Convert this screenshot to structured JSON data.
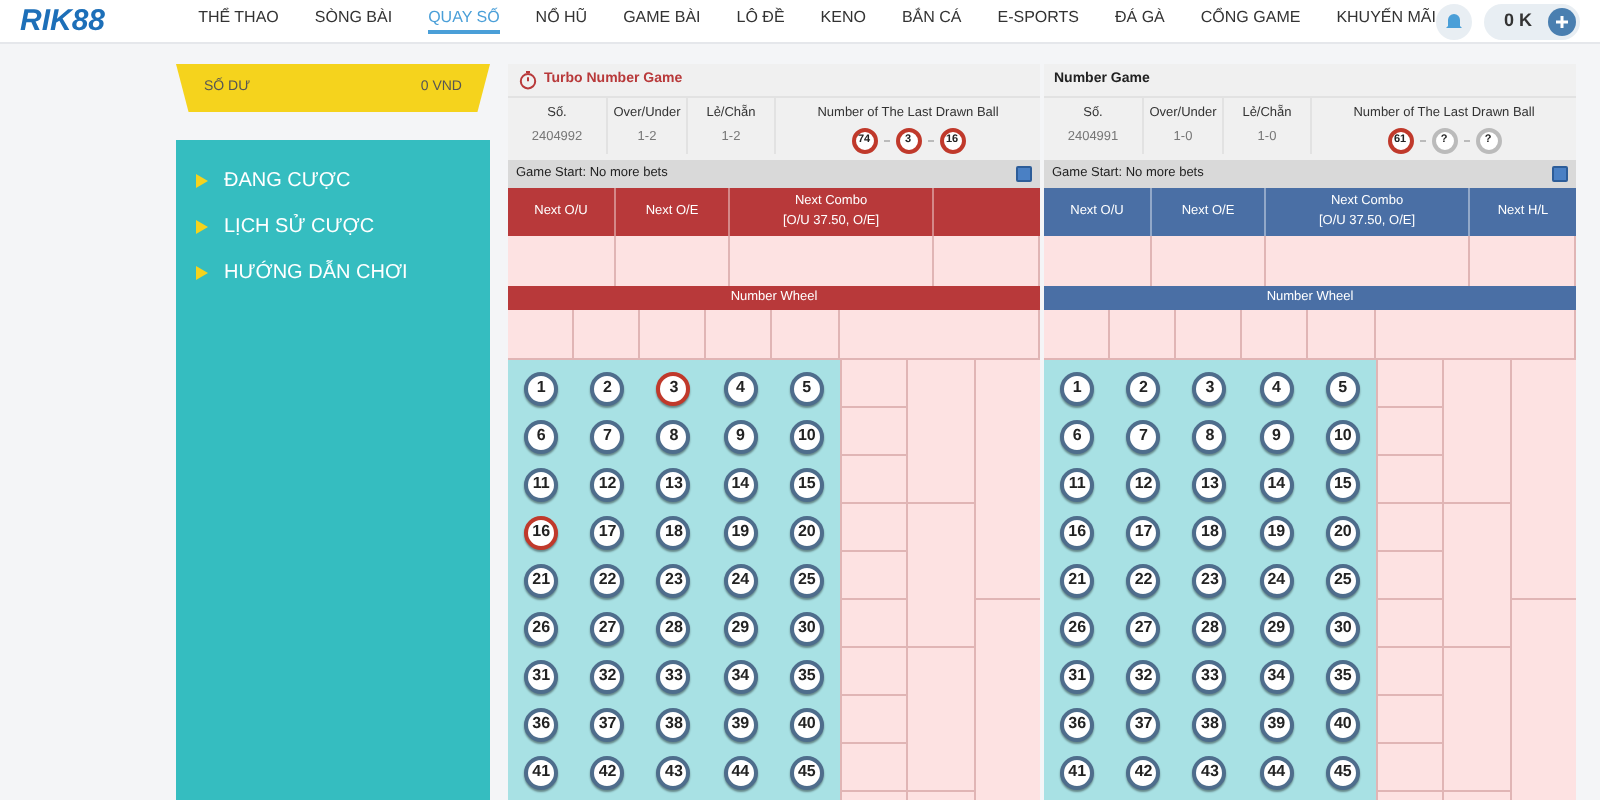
{
  "header": {
    "logo": "RIK88",
    "nav": [
      {
        "label": "THỂ THAO",
        "selected": false
      },
      {
        "label": "SÒNG BÀI",
        "selected": false
      },
      {
        "label": "QUAY SỐ",
        "selected": true
      },
      {
        "label": "NỔ HŨ",
        "selected": false
      },
      {
        "label": "GAME BÀI",
        "selected": false
      },
      {
        "label": "LÔ ĐỀ",
        "selected": false
      },
      {
        "label": "KENO",
        "selected": false
      },
      {
        "label": "BẮN CÁ",
        "selected": false
      },
      {
        "label": "E-SPORTS",
        "selected": false
      },
      {
        "label": "ĐÁ GÀ",
        "selected": false
      },
      {
        "label": "CỔNG GAME",
        "selected": false
      },
      {
        "label": "KHUYẾN MÃI",
        "selected": false
      }
    ],
    "balance": "0 K"
  },
  "sidebar": {
    "balance_label": "SỐ DƯ",
    "balance_value": "0 VND",
    "items": [
      "ĐANG CƯỢC",
      "LỊCH SỬ CƯỢC",
      "HƯỚNG DẪN CHƠI"
    ]
  },
  "panels": [
    {
      "kind": "turbo",
      "title": "Turbo Number Game",
      "info_labels": [
        "Số.",
        "Over/Under",
        "Lẻ/Chẵn",
        "Number of The Last Drawn Ball"
      ],
      "info_values": [
        "2404992",
        "1-2",
        "1-2"
      ],
      "last_balls": [
        {
          "label": "74",
          "drawn": true
        },
        {
          "label": "3",
          "drawn": true
        },
        {
          "label": "16",
          "drawn": true
        }
      ],
      "status": "Game Start: No more bets",
      "columns": [
        {
          "label": "Next O/U"
        },
        {
          "label": "Next O/E"
        },
        {
          "label": "Next Combo",
          "sublabel": "[O/U 37.50, O/E]"
        }
      ],
      "wheel_title": "Number Wheel",
      "balls": [
        {
          "label": "1",
          "drawn": false
        },
        {
          "label": "2",
          "drawn": false
        },
        {
          "label": "3",
          "drawn": true
        },
        {
          "label": "4",
          "drawn": false
        },
        {
          "label": "5",
          "drawn": false
        },
        {
          "label": "6",
          "drawn": false
        },
        {
          "label": "7",
          "drawn": false
        },
        {
          "label": "8",
          "drawn": false
        },
        {
          "label": "9",
          "drawn": false
        },
        {
          "label": "10",
          "drawn": false
        },
        {
          "label": "11",
          "drawn": false
        },
        {
          "label": "12",
          "drawn": false
        },
        {
          "label": "13",
          "drawn": false
        },
        {
          "label": "14",
          "drawn": false
        },
        {
          "label": "15",
          "drawn": false
        },
        {
          "label": "16",
          "drawn": true
        },
        {
          "label": "17",
          "drawn": false
        },
        {
          "label": "18",
          "drawn": false
        },
        {
          "label": "19",
          "drawn": false
        },
        {
          "label": "20",
          "drawn": false
        },
        {
          "label": "21",
          "drawn": false
        },
        {
          "label": "22",
          "drawn": false
        },
        {
          "label": "23",
          "drawn": false
        },
        {
          "label": "24",
          "drawn": false
        },
        {
          "label": "25",
          "drawn": false
        },
        {
          "label": "26",
          "drawn": false
        },
        {
          "label": "27",
          "drawn": false
        },
        {
          "label": "28",
          "drawn": false
        },
        {
          "label": "29",
          "drawn": false
        },
        {
          "label": "30",
          "drawn": false
        },
        {
          "label": "31",
          "drawn": false
        },
        {
          "label": "32",
          "drawn": false
        },
        {
          "label": "33",
          "drawn": false
        },
        {
          "label": "34",
          "drawn": false
        },
        {
          "label": "35",
          "drawn": false
        },
        {
          "label": "36",
          "drawn": false
        },
        {
          "label": "37",
          "drawn": false
        },
        {
          "label": "38",
          "drawn": false
        },
        {
          "label": "39",
          "drawn": false
        },
        {
          "label": "40",
          "drawn": false
        },
        {
          "label": "41",
          "drawn": false
        },
        {
          "label": "42",
          "drawn": false
        },
        {
          "label": "43",
          "drawn": false
        },
        {
          "label": "44",
          "drawn": false
        },
        {
          "label": "45",
          "drawn": false
        }
      ]
    },
    {
      "kind": "standard",
      "title": "Number Game",
      "info_labels": [
        "Số.",
        "Over/Under",
        "Lẻ/Chẵn",
        "Number of The Last Drawn Ball"
      ],
      "info_values": [
        "2404991",
        "1-0",
        "1-0"
      ],
      "last_balls": [
        {
          "label": "61",
          "drawn": true
        },
        {
          "label": "?",
          "drawn": false
        },
        {
          "label": "?",
          "drawn": false
        }
      ],
      "status": "Game Start: No more bets",
      "columns": [
        {
          "label": "Next O/U"
        },
        {
          "label": "Next O/E"
        },
        {
          "label": "Next Combo",
          "sublabel": "[O/U 37.50, O/E]"
        },
        {
          "label": "Next H/L"
        }
      ],
      "wheel_title": "Number Wheel",
      "balls": [
        {
          "label": "1",
          "drawn": false
        },
        {
          "label": "2",
          "drawn": false
        },
        {
          "label": "3",
          "drawn": false
        },
        {
          "label": "4",
          "drawn": false
        },
        {
          "label": "5",
          "drawn": false
        },
        {
          "label": "6",
          "drawn": false
        },
        {
          "label": "7",
          "drawn": false
        },
        {
          "label": "8",
          "drawn": false
        },
        {
          "label": "9",
          "drawn": false
        },
        {
          "label": "10",
          "drawn": false
        },
        {
          "label": "11",
          "drawn": false
        },
        {
          "label": "12",
          "drawn": false
        },
        {
          "label": "13",
          "drawn": false
        },
        {
          "label": "14",
          "drawn": false
        },
        {
          "label": "15",
          "drawn": false
        },
        {
          "label": "16",
          "drawn": false
        },
        {
          "label": "17",
          "drawn": false
        },
        {
          "label": "18",
          "drawn": false
        },
        {
          "label": "19",
          "drawn": false
        },
        {
          "label": "20",
          "drawn": false
        },
        {
          "label": "21",
          "drawn": false
        },
        {
          "label": "22",
          "drawn": false
        },
        {
          "label": "23",
          "drawn": false
        },
        {
          "label": "24",
          "drawn": false
        },
        {
          "label": "25",
          "drawn": false
        },
        {
          "label": "26",
          "drawn": false
        },
        {
          "label": "27",
          "drawn": false
        },
        {
          "label": "28",
          "drawn": false
        },
        {
          "label": "29",
          "drawn": false
        },
        {
          "label": "30",
          "drawn": false
        },
        {
          "label": "31",
          "drawn": false
        },
        {
          "label": "32",
          "drawn": false
        },
        {
          "label": "33",
          "drawn": false
        },
        {
          "label": "34",
          "drawn": false
        },
        {
          "label": "35",
          "drawn": false
        },
        {
          "label": "36",
          "drawn": false
        },
        {
          "label": "37",
          "drawn": false
        },
        {
          "label": "38",
          "drawn": false
        },
        {
          "label": "39",
          "drawn": false
        },
        {
          "label": "40",
          "drawn": false
        },
        {
          "label": "41",
          "drawn": false
        },
        {
          "label": "42",
          "drawn": false
        },
        {
          "label": "43",
          "drawn": false
        },
        {
          "label": "44",
          "drawn": false
        },
        {
          "label": "45",
          "drawn": false
        }
      ]
    }
  ]
}
